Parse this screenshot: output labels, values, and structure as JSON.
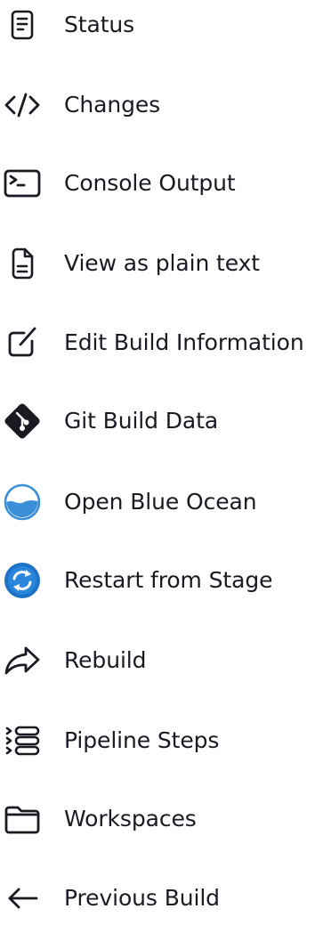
{
  "sidebar": {
    "items": [
      {
        "label": "Status",
        "icon": "document-icon"
      },
      {
        "label": "Changes",
        "icon": "code-icon"
      },
      {
        "label": "Console Output",
        "icon": "terminal-icon"
      },
      {
        "label": "View as plain text",
        "icon": "file-text-icon"
      },
      {
        "label": "Edit Build Information",
        "icon": "edit-icon"
      },
      {
        "label": "Git Build Data",
        "icon": "git-icon"
      },
      {
        "label": "Open Blue Ocean",
        "icon": "blue-ocean-icon"
      },
      {
        "label": "Restart from Stage",
        "icon": "restart-icon"
      },
      {
        "label": "Rebuild",
        "icon": "share-arrow-icon"
      },
      {
        "label": "Pipeline Steps",
        "icon": "list-icon"
      },
      {
        "label": "Workspaces",
        "icon": "folder-icon"
      },
      {
        "label": "Previous Build",
        "icon": "arrow-left-icon"
      }
    ]
  },
  "colors": {
    "text": "#1a1a23",
    "blue_ocean": "#3b8fd8",
    "restart_blue": "#1c73c6"
  }
}
